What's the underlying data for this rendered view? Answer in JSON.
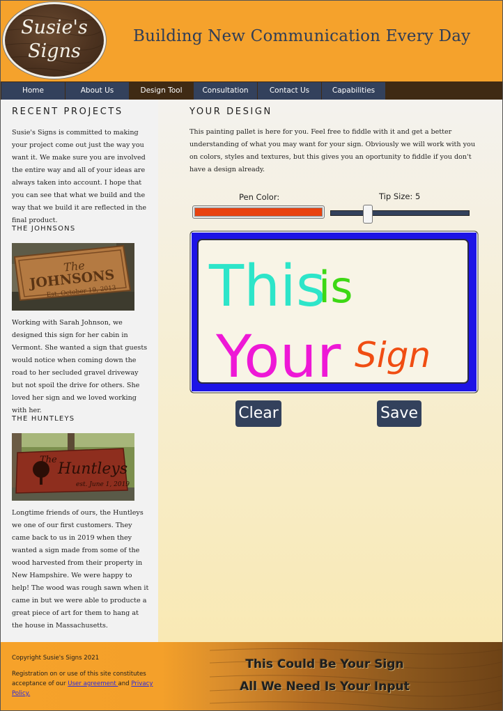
{
  "header": {
    "logo_line1": "Susie's",
    "logo_line2": "Signs",
    "tagline": "Building New Communication Every Day"
  },
  "nav": {
    "items": [
      {
        "label": "Home"
      },
      {
        "label": "About Us"
      },
      {
        "label": "Design Tool",
        "active": true
      },
      {
        "label": "Consultation"
      },
      {
        "label": "Contact Us"
      },
      {
        "label": "Capabilities"
      }
    ]
  },
  "left": {
    "heading": "RECENT PROJECTS",
    "intro": "Susie's Signs is committed to making your project come out just the way you want it. We make sure you are involved the entire way and all of your ideas are always taken into account. I hope that you can see that what we build and the way that we build it are reflected in the final product.",
    "projects": [
      {
        "title": "THE JOHNSONS",
        "sign_line1": "The",
        "sign_line2": "JOHNSONS",
        "sign_line3": "Est. October 19, 2013",
        "text": "Working with Sarah Johnson, we designed this sign for her cabin in Vermont. She wanted a sign that guests would notice when coming down the road to her secluded gravel driveway but not spoil the drive for others. She loved her sign and we loved working with her."
      },
      {
        "title": "THE HUNTLEYS",
        "sign_line1": "The",
        "sign_line2": "Huntleys",
        "sign_line3": "est. June 1, 2019",
        "text": "Longtime friends of ours, the Huntleys we one of our first customers. They came back to us in 2019 when they wanted a sign made from some of the wood harvested from their property in New Hampshire. We were happy to help! The wood was rough sawn when it came in but we were able to producte a great piece of art for them to hang at the house in Massachusetts."
      }
    ]
  },
  "design": {
    "heading": "YOUR DESIGN",
    "intro": "This painting pallet is here for you. Feel free to fiddle with it and get a better understanding of what you may want for your sign. Obviously we will work with you on colors, styles and textures, but this gives you an oportunity to fiddle if you don't have a design already.",
    "pen_color_label": "Pen Color:",
    "pen_color": "#e8420f",
    "tip_size_label": "Tip Size: 5",
    "tip_size": 5,
    "canvas_text": {
      "line1a": "This",
      "line1b": "is",
      "line2a": "Your",
      "line2b": "Sign"
    },
    "canvas_colors": {
      "border": "#1d14e6",
      "fill": "#f8f4e6",
      "this": "#2de5c9",
      "is": "#3dd814",
      "your": "#ee18d6",
      "sign": "#f04d12"
    },
    "clear_label": "Clear",
    "save_label": "Save"
  },
  "footer": {
    "copyright": "Copyright Susie's Signs 2021",
    "registration_prefix": "Registration on or use of this site constitutes acceptance of our ",
    "user_agreement_link": "User agreement ",
    "and_text": "and ",
    "privacy_link": "Privacy Policy.",
    "slogan_line1": "This Could Be Your Sign",
    "slogan_line2": "All We Need Is Your Input"
  },
  "colors": {
    "header_bg": "#f5a22c",
    "nav_bg": "#33415c",
    "nav_active_bg": "#3f2a14",
    "tagline": "#2f3d57",
    "button_bg": "#33415c"
  }
}
